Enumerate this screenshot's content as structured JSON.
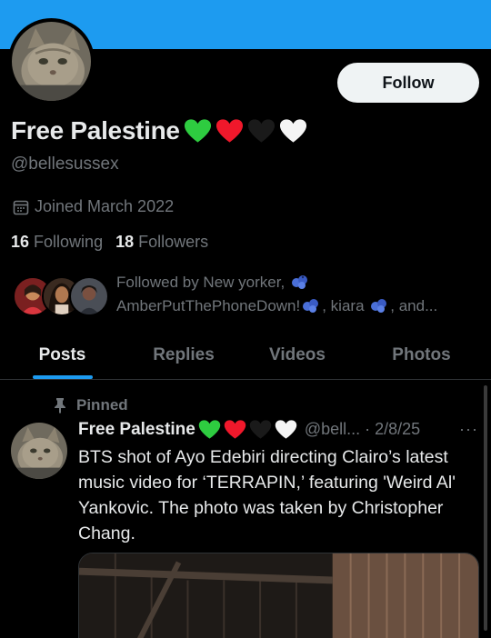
{
  "profile": {
    "display_name": "Free Palestine",
    "handle": "@bellesussex",
    "joined": "Joined March 2022",
    "following_count": "16",
    "following_label": "Following",
    "followers_count": "18",
    "followers_label": "Followers",
    "follow_button": "Follow",
    "name_emojis": [
      "green-heart",
      "red-heart",
      "black-heart",
      "white-heart"
    ]
  },
  "followed_by": {
    "line1": "Followed by New yorker,",
    "line2_a": "AmberPutThePhoneDown!",
    "line2_b": ", kiara",
    "line2_c": ", and..."
  },
  "tabs": [
    {
      "label": "Posts",
      "active": true
    },
    {
      "label": "Replies",
      "active": false
    },
    {
      "label": "Videos",
      "active": false
    },
    {
      "label": "Photos",
      "active": false
    }
  ],
  "post": {
    "pinned_label": "Pinned",
    "author": "Free Palestine",
    "handle_date": "@bell... · 2/8/25",
    "more": "···",
    "text": "BTS shot of Ayo Edebiri directing Clairo’s latest music video for ‘TERRAPIN,’ featuring 'Weird Al' Yankovic. The photo was taken by Christopher Chang."
  },
  "colors": {
    "banner": "#1d9bf0",
    "accent": "#1d9bf0",
    "muted": "#71767b",
    "text": "#e7e9ea",
    "background": "#000000"
  }
}
